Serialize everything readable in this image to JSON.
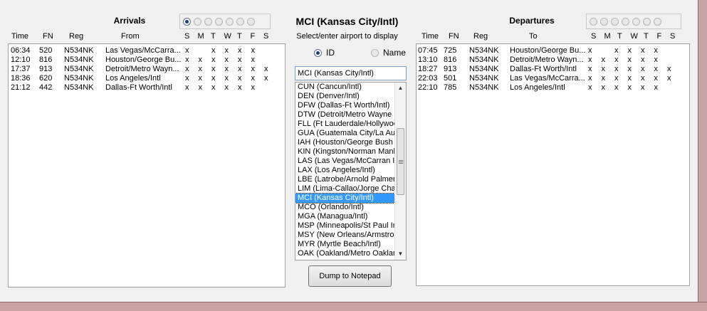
{
  "arrivals": {
    "title": "Arrivals",
    "radio_count": 7,
    "selected_radio": 0,
    "headers": {
      "time": "Time",
      "fn": "FN",
      "reg": "Reg",
      "from": "From",
      "days": [
        "S",
        "M",
        "T",
        "W",
        "T",
        "F",
        "S"
      ]
    },
    "rows": [
      {
        "time": "06:34",
        "fn": "520",
        "reg": "N534NK",
        "place": "Las Vegas/McCarra...",
        "days": [
          "x",
          "",
          "x",
          "x",
          "x",
          "x",
          ""
        ]
      },
      {
        "time": "12:10",
        "fn": "816",
        "reg": "N534NK",
        "place": "Houston/George Bu...",
        "days": [
          "x",
          "x",
          "x",
          "x",
          "x",
          "x",
          ""
        ]
      },
      {
        "time": "17:37",
        "fn": "913",
        "reg": "N534NK",
        "place": "Detroit/Metro Wayn...",
        "days": [
          "x",
          "x",
          "x",
          "x",
          "x",
          "x",
          "x"
        ]
      },
      {
        "time": "18:36",
        "fn": "620",
        "reg": "N534NK",
        "place": "Los Angeles/Intl",
        "days": [
          "x",
          "x",
          "x",
          "x",
          "x",
          "x",
          "x"
        ]
      },
      {
        "time": "21:12",
        "fn": "442",
        "reg": "N534NK",
        "place": "Dallas-Ft Worth/Intl",
        "days": [
          "x",
          "x",
          "x",
          "x",
          "x",
          "x",
          ""
        ]
      }
    ]
  },
  "center": {
    "title": "MCI (Kansas City/Intl)",
    "prompt": "Select/enter airport to display",
    "option_id": "ID",
    "option_name": "Name",
    "selected_option": "ID",
    "input_value": "MCI (Kansas City/Intl)",
    "airports": [
      "CUN (Cancun/Intl)",
      "DEN (Denver/Intl)",
      "DFW (Dallas-Ft Worth/Intl)",
      "DTW (Detroit/Metro Wayne",
      "FLL (Ft Lauderdale/Hollywoo",
      "GUA (Guatemala City/La Aur",
      "IAH (Houston/George Bush",
      "KIN (Kingston/Norman Manle",
      "LAS (Las Vegas/McCarran In",
      "LAX (Los Angeles/Intl)",
      "LBE (Latrobe/Arnold Palmer",
      "LIM (Lima-Callao/Jorge Chav",
      "MCI (Kansas City/Intl)",
      "MCO (Orlando/Intl)",
      "MGA (Managua/Intl)",
      "MSP (Minneapolis/St Paul In",
      "MSY (New Orleans/Armstron",
      "MYR (Myrtle Beach/Intl)",
      "OAK (Oakland/Metro Oaklan"
    ],
    "selected_airport_index": 12,
    "dump_button": "Dump to Notepad"
  },
  "departures": {
    "title": "Departures",
    "radio_count": 7,
    "selected_radio": -1,
    "headers": {
      "time": "Time",
      "fn": "FN",
      "reg": "Reg",
      "to": "To",
      "days": [
        "S",
        "M",
        "T",
        "W",
        "T",
        "F",
        "S"
      ]
    },
    "rows": [
      {
        "time": "07:45",
        "fn": "725",
        "reg": "N534NK",
        "place": "Houston/George Bu...",
        "days": [
          "x",
          "",
          "x",
          "x",
          "x",
          "x",
          ""
        ]
      },
      {
        "time": "13:10",
        "fn": "816",
        "reg": "N534NK",
        "place": "Detroit/Metro Wayn...",
        "days": [
          "x",
          "x",
          "x",
          "x",
          "x",
          "x",
          ""
        ]
      },
      {
        "time": "18:27",
        "fn": "913",
        "reg": "N534NK",
        "place": "Dallas-Ft Worth/Intl",
        "days": [
          "x",
          "x",
          "x",
          "x",
          "x",
          "x",
          "x"
        ]
      },
      {
        "time": "22:03",
        "fn": "501",
        "reg": "N534NK",
        "place": "Las Vegas/McCarra...",
        "days": [
          "x",
          "x",
          "x",
          "x",
          "x",
          "x",
          "x"
        ]
      },
      {
        "time": "22:10",
        "fn": "785",
        "reg": "N534NK",
        "place": "Los Angeles/Intl",
        "days": [
          "x",
          "x",
          "x",
          "x",
          "x",
          "x",
          ""
        ]
      }
    ]
  }
}
